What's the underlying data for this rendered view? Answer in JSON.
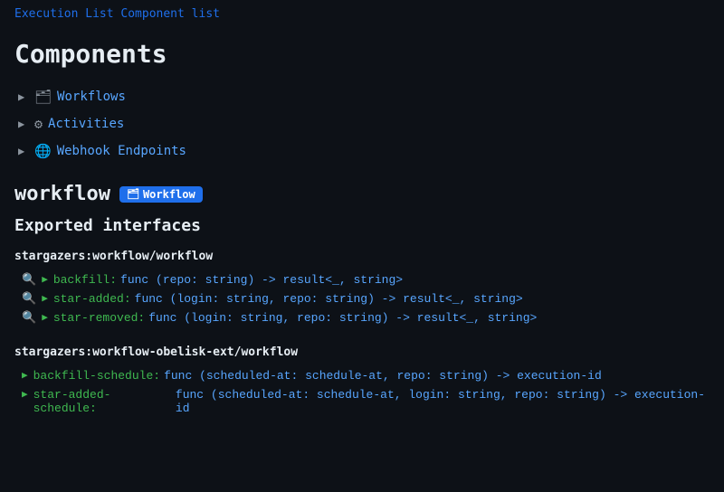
{
  "breadcrumb": {
    "parts": [
      "Execution List",
      "Component list"
    ],
    "text": "Execution List Component list"
  },
  "page": {
    "title": "Components"
  },
  "nav": {
    "items": [
      {
        "id": "workflows",
        "label": "Workflows",
        "icon": "🗂"
      },
      {
        "id": "activities",
        "label": "Activities",
        "icon": "⚙"
      },
      {
        "id": "webhook-endpoints",
        "label": "Webhook Endpoints",
        "icon": "🌐"
      }
    ]
  },
  "workflow_section": {
    "title": "workflow",
    "badge_label": "Workflow",
    "badge_icon": "🗂"
  },
  "exported_interfaces": {
    "title": "Exported interfaces",
    "namespaces": [
      {
        "id": "ns1",
        "label": "stargazers:workflow/workflow",
        "functions": [
          {
            "id": "f1",
            "name": "backfill",
            "signature": "func (repo: string) -> result<_, string>",
            "has_search": true,
            "has_play": true
          },
          {
            "id": "f2",
            "name": "star-added",
            "signature": "func (login: string, repo: string) -> result<_, string>",
            "has_search": true,
            "has_play": true
          },
          {
            "id": "f3",
            "name": "star-removed",
            "signature": "func (login: string, repo: string) -> result<_, string>",
            "has_search": true,
            "has_play": true
          }
        ]
      },
      {
        "id": "ns2",
        "label": "stargazers:workflow-obelisk-ext/workflow",
        "functions": [
          {
            "id": "f4",
            "name": "backfill-schedule",
            "signature": "func (scheduled-at: schedule-at, repo: string) -> execution-id",
            "has_search": false,
            "has_play": true
          },
          {
            "id": "f5",
            "name": "star-added-schedule",
            "signature": "func (scheduled-at: schedule-at, login: string, repo: string) -> execution-id",
            "has_search": false,
            "has_play": true
          }
        ]
      }
    ]
  }
}
